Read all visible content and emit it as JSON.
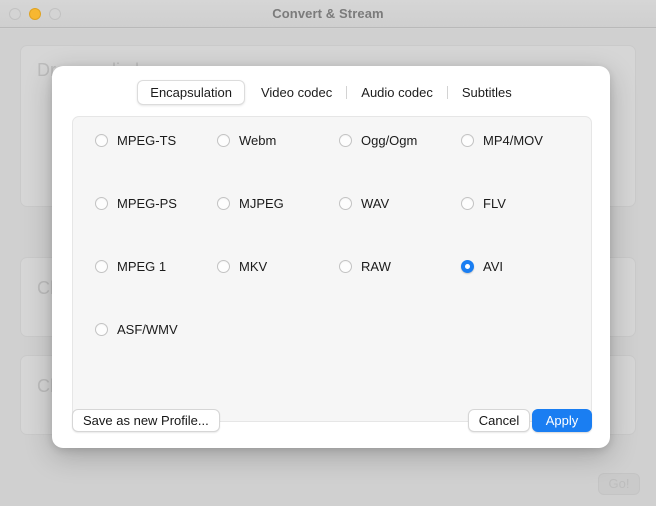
{
  "window": {
    "title": "Convert & Stream",
    "traffic_lights": [
      {
        "name": "close",
        "color": "#d4d4d4"
      },
      {
        "name": "minimize",
        "color": "#f7b731"
      },
      {
        "name": "zoom",
        "color": "#d4d4d4"
      }
    ]
  },
  "background": {
    "drop_zone_label": "Drop media here",
    "choose_profile_label": "Choose Profile",
    "choose_destination_label": "Choose Destination",
    "go_button_label": "Go!"
  },
  "dialog": {
    "tabs": [
      {
        "label": "Encapsulation",
        "selected": true
      },
      {
        "label": "Video codec",
        "selected": false
      },
      {
        "label": "Audio codec",
        "selected": false
      },
      {
        "label": "Subtitles",
        "selected": false
      }
    ],
    "selected_accent_color": "#1a7ef2",
    "options": [
      {
        "label": "MPEG-TS",
        "checked": false,
        "col": 0,
        "row": 0
      },
      {
        "label": "Webm",
        "checked": false,
        "col": 1,
        "row": 0
      },
      {
        "label": "Ogg/Ogm",
        "checked": false,
        "col": 2,
        "row": 0
      },
      {
        "label": "MP4/MOV",
        "checked": false,
        "col": 3,
        "row": 0
      },
      {
        "label": "MPEG-PS",
        "checked": false,
        "col": 0,
        "row": 1
      },
      {
        "label": "MJPEG",
        "checked": false,
        "col": 1,
        "row": 1
      },
      {
        "label": "WAV",
        "checked": false,
        "col": 2,
        "row": 1
      },
      {
        "label": "FLV",
        "checked": false,
        "col": 3,
        "row": 1
      },
      {
        "label": "MPEG 1",
        "checked": false,
        "col": 0,
        "row": 2
      },
      {
        "label": "MKV",
        "checked": false,
        "col": 1,
        "row": 2
      },
      {
        "label": "RAW",
        "checked": false,
        "col": 2,
        "row": 2
      },
      {
        "label": "AVI",
        "checked": true,
        "col": 3,
        "row": 2
      },
      {
        "label": "ASF/WMV",
        "checked": false,
        "col": 0,
        "row": 3
      }
    ],
    "buttons": {
      "save_profile": "Save as new Profile...",
      "cancel": "Cancel",
      "apply": "Apply"
    }
  }
}
